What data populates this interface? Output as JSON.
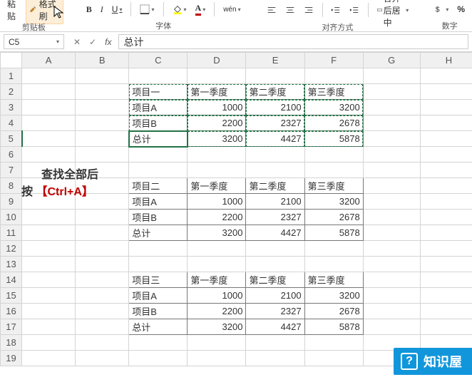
{
  "ribbon": {
    "paste_label": "粘贴",
    "format_painter": "格式刷",
    "group_clipboard": "剪贴板",
    "group_font": "字体",
    "group_align": "对齐方式",
    "group_number": "数字",
    "bold": "B",
    "italic": "I",
    "underline": "U",
    "wen": "wén",
    "merge_center": "合并后居中"
  },
  "formula_bar": {
    "cell_ref": "C5",
    "value": "总计"
  },
  "columns": [
    "A",
    "B",
    "C",
    "D",
    "E",
    "F",
    "G",
    "H"
  ],
  "annotation": {
    "line1": "查找全部后",
    "line2_prefix": "按",
    "line2_shortcut": "【Ctrl+A】"
  },
  "tables": [
    {
      "header": [
        "项目一",
        "第一季度",
        "第二季度",
        "第三季度"
      ],
      "rows": [
        [
          "项目A",
          1000,
          2100,
          3200
        ],
        [
          "项目B",
          2200,
          2327,
          2678
        ],
        [
          "总计",
          3200,
          4427,
          5878
        ]
      ]
    },
    {
      "header": [
        "项目二",
        "第一季度",
        "第二季度",
        "第三季度"
      ],
      "rows": [
        [
          "项目A",
          1000,
          2100,
          3200
        ],
        [
          "项目B",
          2200,
          2327,
          2678
        ],
        [
          "总计",
          3200,
          4427,
          5878
        ]
      ]
    },
    {
      "header": [
        "项目三",
        "第一季度",
        "第二季度",
        "第三季度"
      ],
      "rows": [
        [
          "项目A",
          1000,
          2100,
          3200
        ],
        [
          "项目B",
          2200,
          2327,
          2678
        ],
        [
          "总计",
          3200,
          4427,
          5878
        ]
      ]
    }
  ],
  "watermark": "知识屋",
  "percent_sign": "%"
}
